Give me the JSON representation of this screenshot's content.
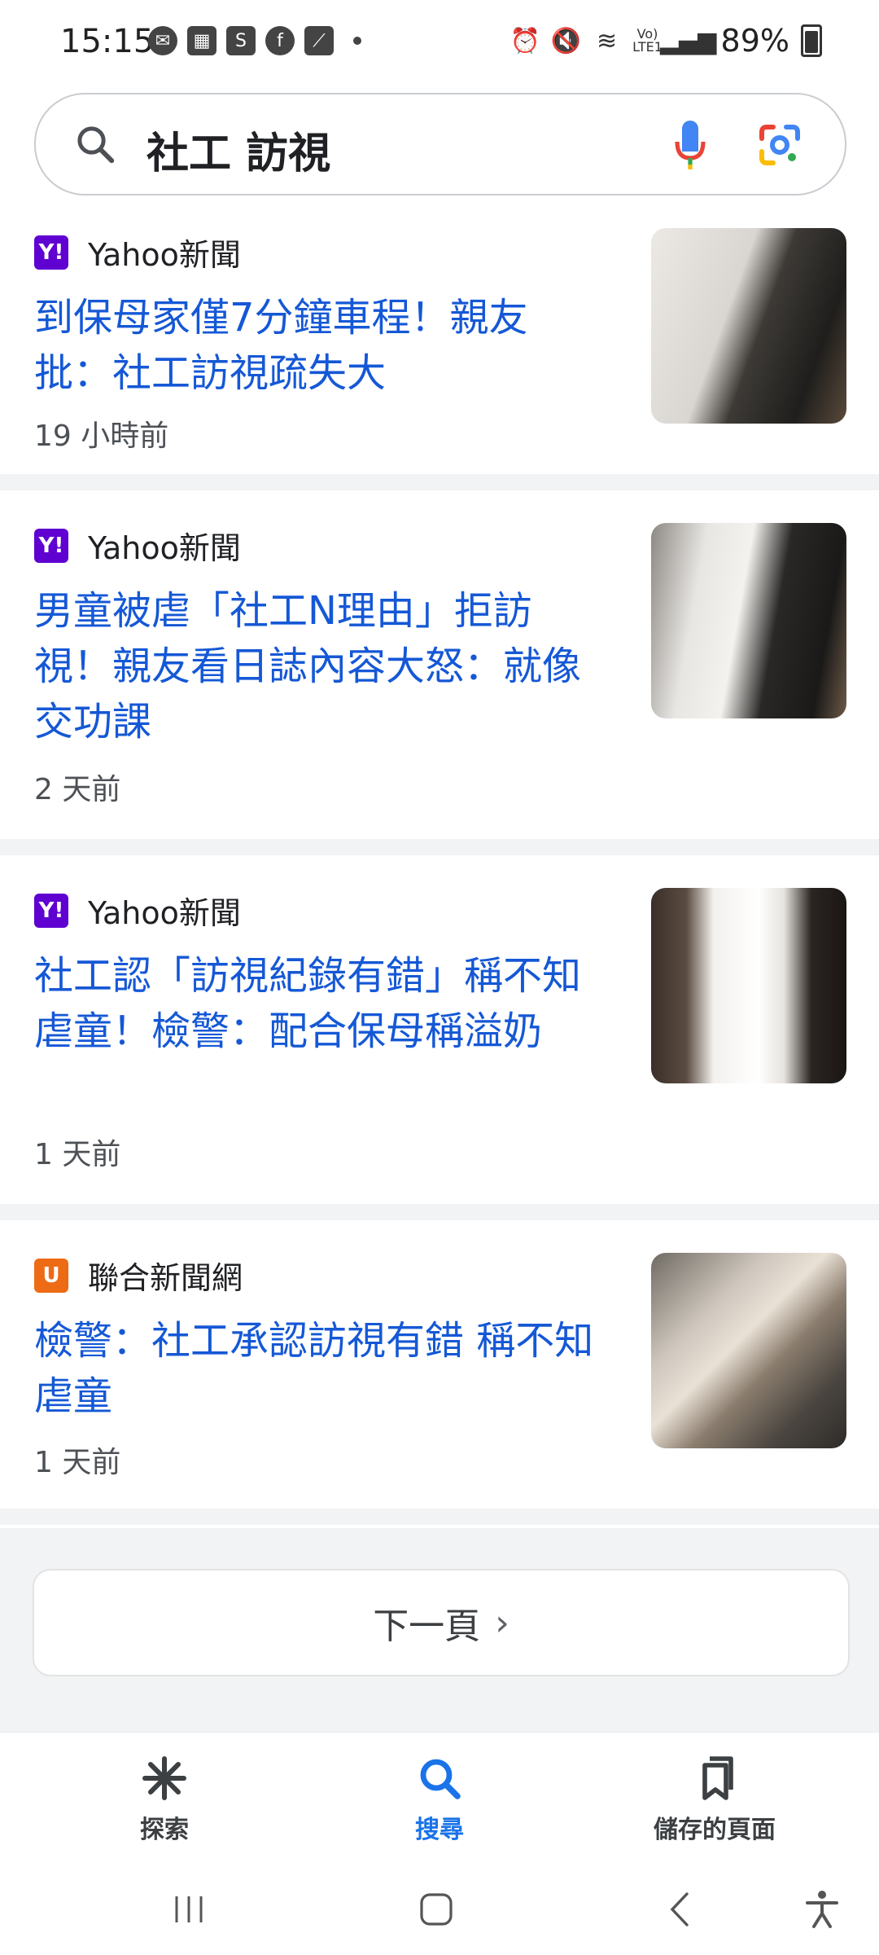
{
  "status_bar": {
    "time": "15:15",
    "battery": "89%",
    "left_icons": [
      "messenger-icon",
      "app-icon",
      "shop-icon",
      "facebook-icon",
      "chart-icon"
    ],
    "right_icons": [
      "alarm-icon",
      "mute-icon",
      "wifi-icon",
      "volte-icon",
      "signal-icon"
    ],
    "volte_label": "Vo) LTE1"
  },
  "search": {
    "query": "社工 訪視"
  },
  "results": [
    {
      "source": "Yahoo新聞",
      "logo": "Y!",
      "title": "到保母家僅7分鐘車程！親友批：社工訪視疏失大",
      "time": "19 小時前"
    },
    {
      "source": "Yahoo新聞",
      "logo": "Y!",
      "title": "男童被虐「社工N理由」拒訪視！親友看日誌內容大怒：就像交功課",
      "time": "2 天前"
    },
    {
      "source": "Yahoo新聞",
      "logo": "Y!",
      "title": "社工認「訪視紀錄有錯」稱不知虐童！檢警：配合保母稱溢奶",
      "time": "1 天前"
    },
    {
      "source": "聯合新聞網",
      "logo": "U",
      "title": "檢警：社工承認訪視有錯 稱不知虐童",
      "time": "1 天前"
    }
  ],
  "pagination": {
    "next_label": "下一頁",
    "next_chevron": "›"
  },
  "bottom_nav": {
    "items": [
      {
        "label": "探索",
        "icon": "asterisk-icon",
        "active": false
      },
      {
        "label": "搜尋",
        "icon": "search-icon",
        "active": true
      },
      {
        "label": "儲存的頁面",
        "icon": "bookmark-icon",
        "active": false
      }
    ]
  },
  "colors": {
    "link": "#1558d6",
    "accent": "#1a73e8",
    "yahoo": "#5f01d1",
    "udn": "#ee6b16",
    "divider": "#f1f3f4"
  }
}
